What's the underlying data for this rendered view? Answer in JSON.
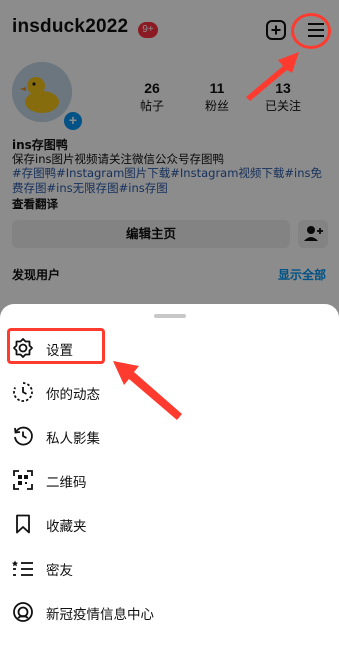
{
  "header": {
    "username": "insduck2022",
    "notification_badge": "9+",
    "add_icon": "plus-square-icon",
    "menu_icon": "hamburger-menu-icon"
  },
  "profile": {
    "stats": [
      {
        "value": "26",
        "label": "帖子"
      },
      {
        "value": "11",
        "label": "粉丝"
      },
      {
        "value": "13",
        "label": "已关注"
      }
    ],
    "name": "ins存图鸭",
    "bio": "保存ins图片视频请关注微信公众号存图鸭",
    "tags": "#存图鸭#Instagram图片下载#Instagram视频下载#ins免费存图#ins无限存图#ins存图",
    "translate": "查看翻译",
    "edit_profile": "编辑主页",
    "discover_people": "发现用户",
    "show_all": "显示全部"
  },
  "menu": {
    "items": [
      {
        "label": "设置",
        "icon": "settings-gear-icon"
      },
      {
        "label": "你的动态",
        "icon": "activity-clock-icon"
      },
      {
        "label": "私人影集",
        "icon": "archive-history-icon"
      },
      {
        "label": "二维码",
        "icon": "qr-code-icon"
      },
      {
        "label": "收藏夹",
        "icon": "bookmark-icon"
      },
      {
        "label": "密友",
        "icon": "close-friends-list-icon"
      },
      {
        "label": "新冠疫情信息中心",
        "icon": "covid-info-icon"
      }
    ]
  },
  "colors": {
    "annotation_red": "#ff3b30",
    "link_blue": "#0095f6",
    "badge_red": "#ff3040"
  }
}
